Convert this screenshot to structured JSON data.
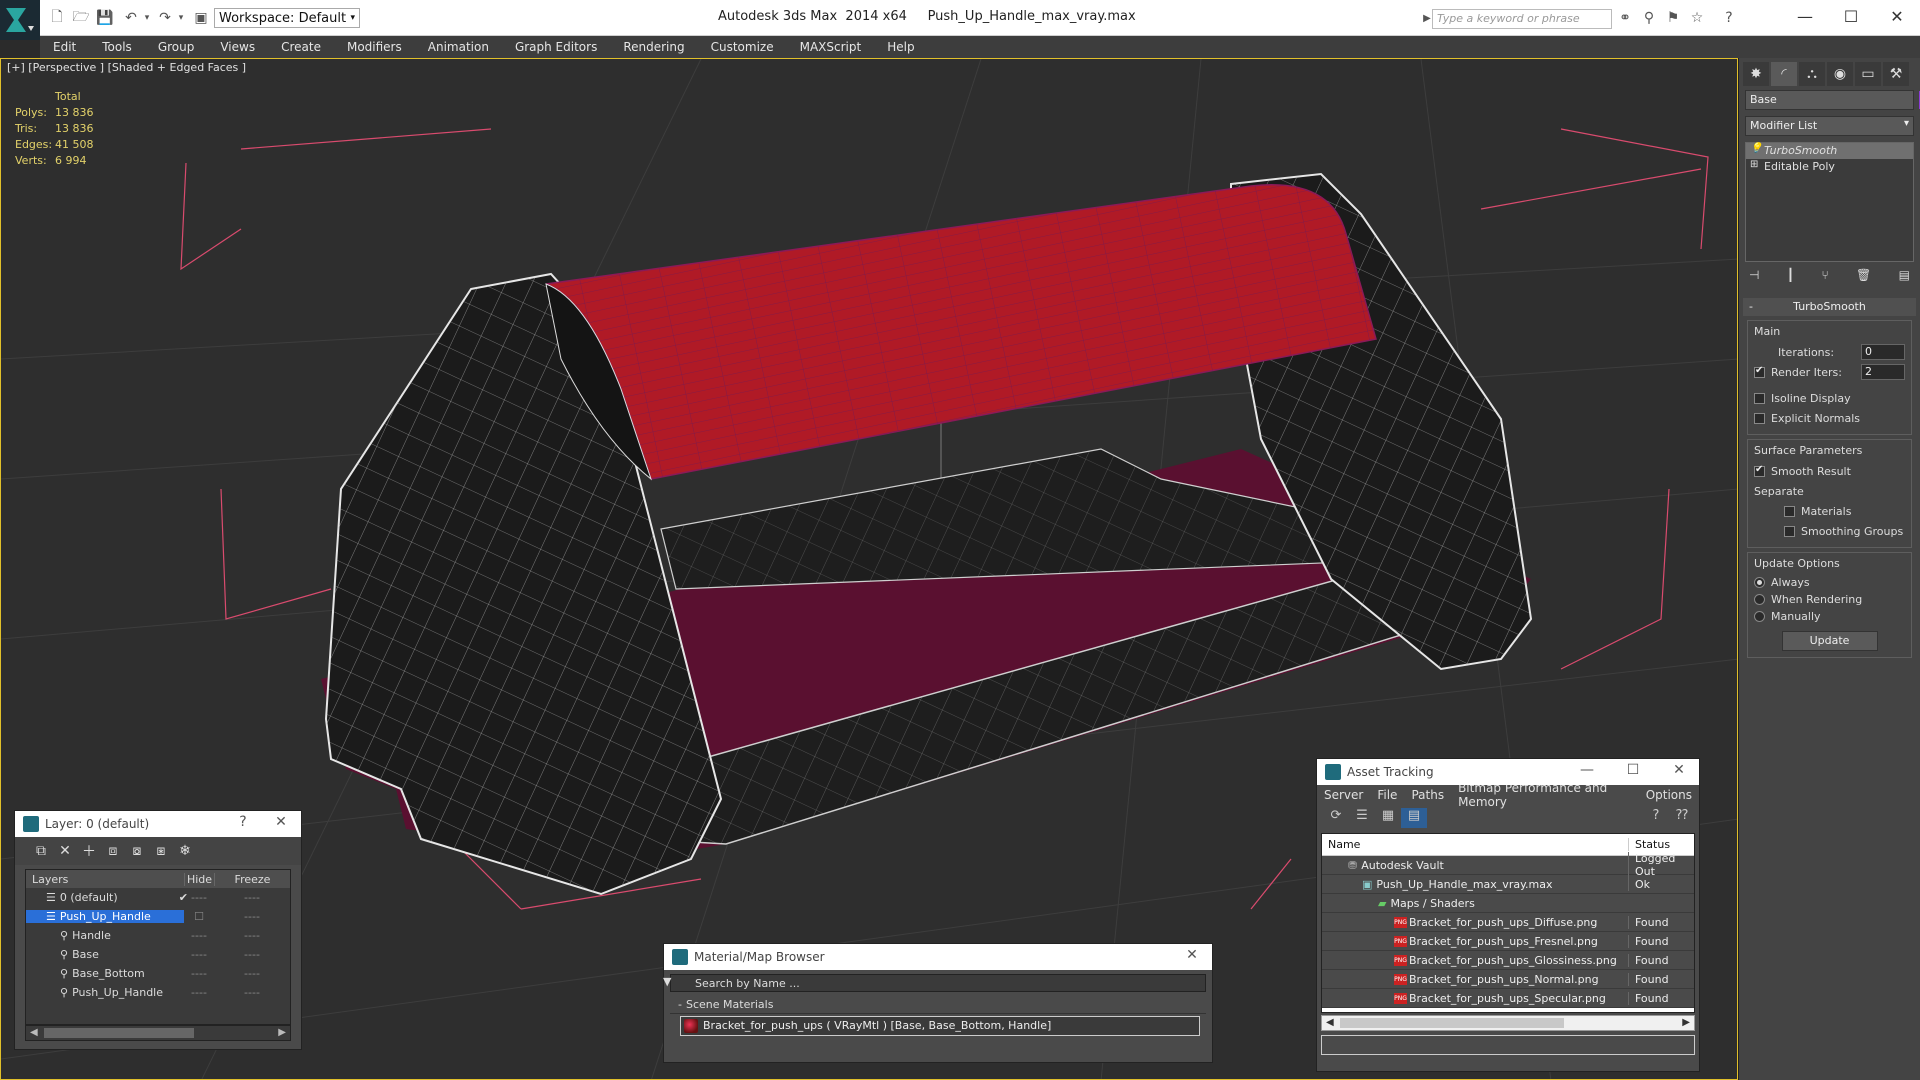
{
  "titlebar": {
    "app_title": "Autodesk 3ds Max  2014 x64",
    "file_name": "Push_Up_Handle_max_vray.max",
    "workspace": "Workspace: Default",
    "search_placeholder": "Type a keyword or phrase"
  },
  "menu": [
    "Edit",
    "Tools",
    "Group",
    "Views",
    "Create",
    "Modifiers",
    "Animation",
    "Graph Editors",
    "Rendering",
    "Customize",
    "MAXScript",
    "Help"
  ],
  "viewport": {
    "label": "[+] [Perspective ] [Shaded + Edged Faces ]",
    "stats": {
      "total_label": "Total",
      "rows": [
        {
          "k": "Polys:",
          "v": "13 836"
        },
        {
          "k": "Tris:",
          "v": "13 836"
        },
        {
          "k": "Edges:",
          "v": "41 508"
        },
        {
          "k": "Verts:",
          "v": "6 994"
        }
      ]
    },
    "colors": {
      "handle": "#b01a26",
      "frame": "#1e1e1e",
      "bbox": "#d94b6e"
    }
  },
  "command_panel": {
    "object_name": "Base",
    "object_color": "#8a3ad4",
    "modifier_list": "Modifier List",
    "stack": [
      "TurboSmooth",
      "Editable Poly"
    ],
    "rollout": "TurboSmooth",
    "main": {
      "title": "Main",
      "iterations_label": "Iterations:",
      "iterations": "0",
      "render_iters_label": "Render Iters:",
      "render_iters": "2",
      "isoline": "Isoline Display",
      "explicit": "Explicit Normals"
    },
    "surface": {
      "title": "Surface Parameters",
      "smooth": "Smooth Result",
      "separate": "Separate",
      "materials": "Materials",
      "smoothing_groups": "Smoothing Groups"
    },
    "update": {
      "title": "Update Options",
      "always": "Always",
      "when_rendering": "When Rendering",
      "manually": "Manually",
      "button": "Update"
    }
  },
  "layer_window": {
    "title": "Layer: 0 (default)",
    "help": "?",
    "columns": {
      "layers": "Layers",
      "hide": "Hide",
      "freeze": "Freeze"
    },
    "rows": [
      {
        "name": "0 (default)",
        "indent": 1,
        "selected": false,
        "check": true
      },
      {
        "name": "Push_Up_Handle",
        "indent": 1,
        "selected": true,
        "check": false
      },
      {
        "name": "Handle",
        "indent": 2,
        "selected": false,
        "check": false
      },
      {
        "name": "Base",
        "indent": 2,
        "selected": false,
        "check": false
      },
      {
        "name": "Base_Bottom",
        "indent": 2,
        "selected": false,
        "check": false
      },
      {
        "name": "Push_Up_Handle",
        "indent": 2,
        "selected": false,
        "check": false
      }
    ],
    "dash": "----"
  },
  "material_browser": {
    "title": "Material/Map Browser",
    "search": "Search by Name ...",
    "section": "Scene Materials",
    "item": "Bracket_for_push_ups  ( VRayMtl ) [Base, Base_Bottom, Handle]"
  },
  "asset_tracking": {
    "title": "Asset Tracking",
    "menu": [
      "Server",
      "File",
      "Paths",
      "Bitmap Performance and Memory",
      "Options"
    ],
    "columns": {
      "name": "Name",
      "status": "Status"
    },
    "rows": [
      {
        "name": "Autodesk Vault",
        "status": "Logged Out",
        "indent": 1,
        "icon": "vault"
      },
      {
        "name": "Push_Up_Handle_max_vray.max",
        "status": "Ok",
        "indent": 2,
        "icon": "file"
      },
      {
        "name": "Maps / Shaders",
        "status": "",
        "indent": 3,
        "icon": "maps"
      },
      {
        "name": "Bracket_for_push_ups_Diffuse.png",
        "status": "Found",
        "indent": 4,
        "icon": "png"
      },
      {
        "name": "Bracket_for_push_ups_Fresnel.png",
        "status": "Found",
        "indent": 4,
        "icon": "png"
      },
      {
        "name": "Bracket_for_push_ups_Glossiness.png",
        "status": "Found",
        "indent": 4,
        "icon": "png"
      },
      {
        "name": "Bracket_for_push_ups_Normal.png",
        "status": "Found",
        "indent": 4,
        "icon": "png"
      },
      {
        "name": "Bracket_for_push_ups_Specular.png",
        "status": "Found",
        "indent": 4,
        "icon": "png"
      }
    ],
    "png_label": "PNG"
  }
}
